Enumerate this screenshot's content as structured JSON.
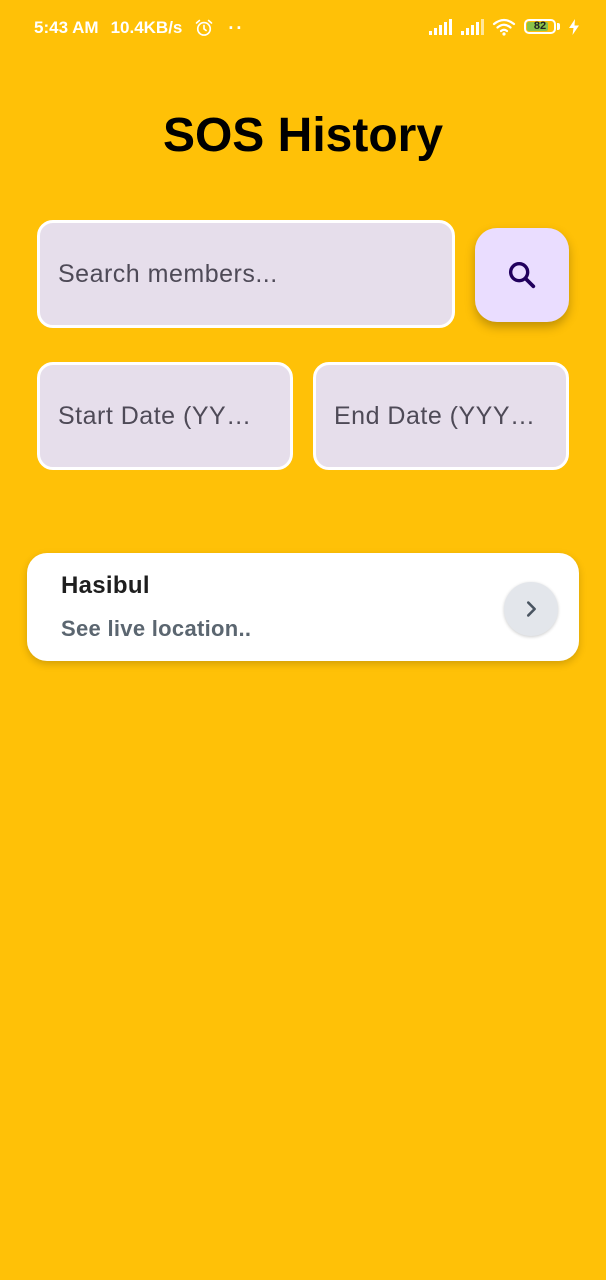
{
  "status_bar": {
    "time": "5:43 AM",
    "network_speed": "10.4KB/s",
    "extra_indicator": "··",
    "battery_level": "82",
    "battery_fraction": 0.82,
    "icons": [
      "alarm-icon",
      "signal-icon",
      "signal-icon",
      "wifi-icon",
      "battery-icon",
      "charging-icon"
    ]
  },
  "page": {
    "title": "SOS History",
    "background_color": "#FFC107"
  },
  "search": {
    "placeholder": "Search members...",
    "value": "",
    "button_icon": "search-icon"
  },
  "date_filters": {
    "start_placeholder": "Start Date (YY…",
    "end_placeholder": "End Date (YYY…"
  },
  "members": [
    {
      "name": "Hasibul",
      "subtitle": "See live location..",
      "action_icon": "chevron-right-icon"
    }
  ],
  "colors": {
    "accent": "#FFC107",
    "field_bg": "#E6DEEB",
    "search_button_bg": "#EADDFF",
    "search_icon": "#21005D",
    "battery_fill": "#8BC34A"
  }
}
